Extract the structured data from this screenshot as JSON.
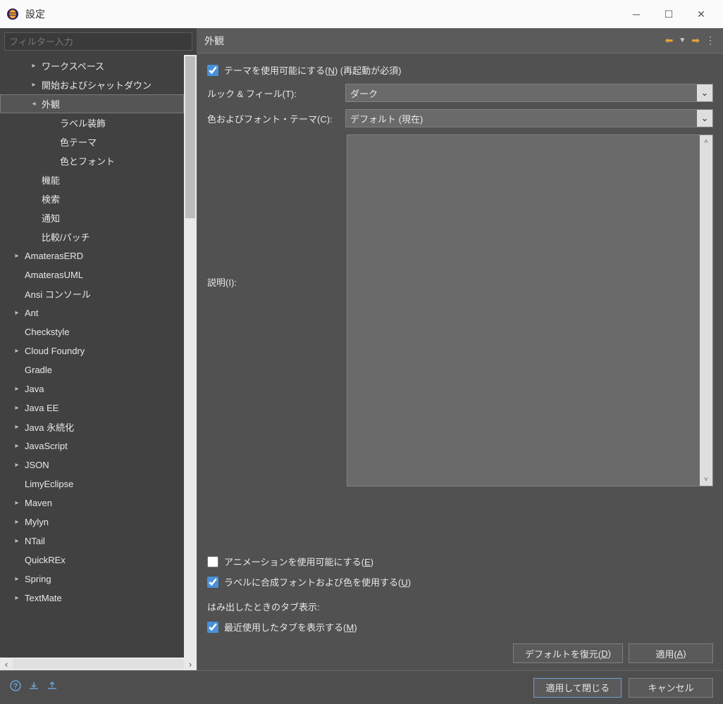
{
  "window": {
    "title": "設定"
  },
  "filter": {
    "placeholder": "フィルター入力"
  },
  "tree": [
    {
      "label": "ワークスペース",
      "indent": 40,
      "arrow": "▸"
    },
    {
      "label": "開始およびシャットダウン",
      "indent": 40,
      "arrow": "▸"
    },
    {
      "label": "外観",
      "indent": 40,
      "arrow": "◂",
      "selected": true
    },
    {
      "label": "ラベル装飾",
      "indent": 66
    },
    {
      "label": "色テーマ",
      "indent": 66
    },
    {
      "label": "色とフォント",
      "indent": 66
    },
    {
      "label": "機能",
      "indent": 40
    },
    {
      "label": "検索",
      "indent": 40
    },
    {
      "label": "通知",
      "indent": 40
    },
    {
      "label": "比較/パッチ",
      "indent": 40
    },
    {
      "label": "AmaterasERD",
      "indent": 16,
      "arrow": "▸"
    },
    {
      "label": "AmaterasUML",
      "indent": 16
    },
    {
      "label": "Ansi コンソール",
      "indent": 16
    },
    {
      "label": "Ant",
      "indent": 16,
      "arrow": "▸"
    },
    {
      "label": "Checkstyle",
      "indent": 16
    },
    {
      "label": "Cloud Foundry",
      "indent": 16,
      "arrow": "▸"
    },
    {
      "label": "Gradle",
      "indent": 16
    },
    {
      "label": "Java",
      "indent": 16,
      "arrow": "▸"
    },
    {
      "label": "Java EE",
      "indent": 16,
      "arrow": "▸"
    },
    {
      "label": "Java 永続化",
      "indent": 16,
      "arrow": "▸"
    },
    {
      "label": "JavaScript",
      "indent": 16,
      "arrow": "▸"
    },
    {
      "label": "JSON",
      "indent": 16,
      "arrow": "▸"
    },
    {
      "label": "LimyEclipse",
      "indent": 16
    },
    {
      "label": "Maven",
      "indent": 16,
      "arrow": "▸"
    },
    {
      "label": "Mylyn",
      "indent": 16,
      "arrow": "▸"
    },
    {
      "label": "NTail",
      "indent": 16,
      "arrow": "▸"
    },
    {
      "label": "QuickREx",
      "indent": 16
    },
    {
      "label": "Spring",
      "indent": 16,
      "arrow": "▸"
    },
    {
      "label": "TextMate",
      "indent": 16,
      "arrow": "▸"
    }
  ],
  "page": {
    "title": "外観",
    "enable_theme_label_pre": "テーマを使用可能にする(",
    "enable_theme_key": "N",
    "enable_theme_label_post": ") (再起動が必須)",
    "enable_theme_checked": true,
    "look_feel_label": "ルック & フィール(T):",
    "look_feel_value": "ダーク",
    "color_font_theme_label": "色およびフォント・テーマ(C):",
    "color_font_theme_value": "デフォルト (現在)",
    "description_label": "説明(I):",
    "animation_label_pre": "アニメーションを使用可能にする(",
    "animation_key": "E",
    "animation_label_post": ")",
    "animation_checked": false,
    "synth_font_label_pre": "ラベルに合成フォントおよび色を使用する(",
    "synth_font_key": "U",
    "synth_font_label_post": ")",
    "synth_font_checked": true,
    "overflow_tab_section": "はみ出したときのタブ表示:",
    "recent_tab_label_pre": "最近使用したタブを表示する(",
    "recent_tab_key": "M",
    "recent_tab_label_post": ")",
    "recent_tab_checked": true,
    "restore_defaults_pre": "デフォルトを復元(",
    "restore_defaults_key": "D",
    "restore_defaults_post": ")",
    "apply_pre": "適用(",
    "apply_key": "A",
    "apply_post": ")"
  },
  "footer": {
    "apply_close": "適用して閉じる",
    "cancel": "キャンセル"
  }
}
